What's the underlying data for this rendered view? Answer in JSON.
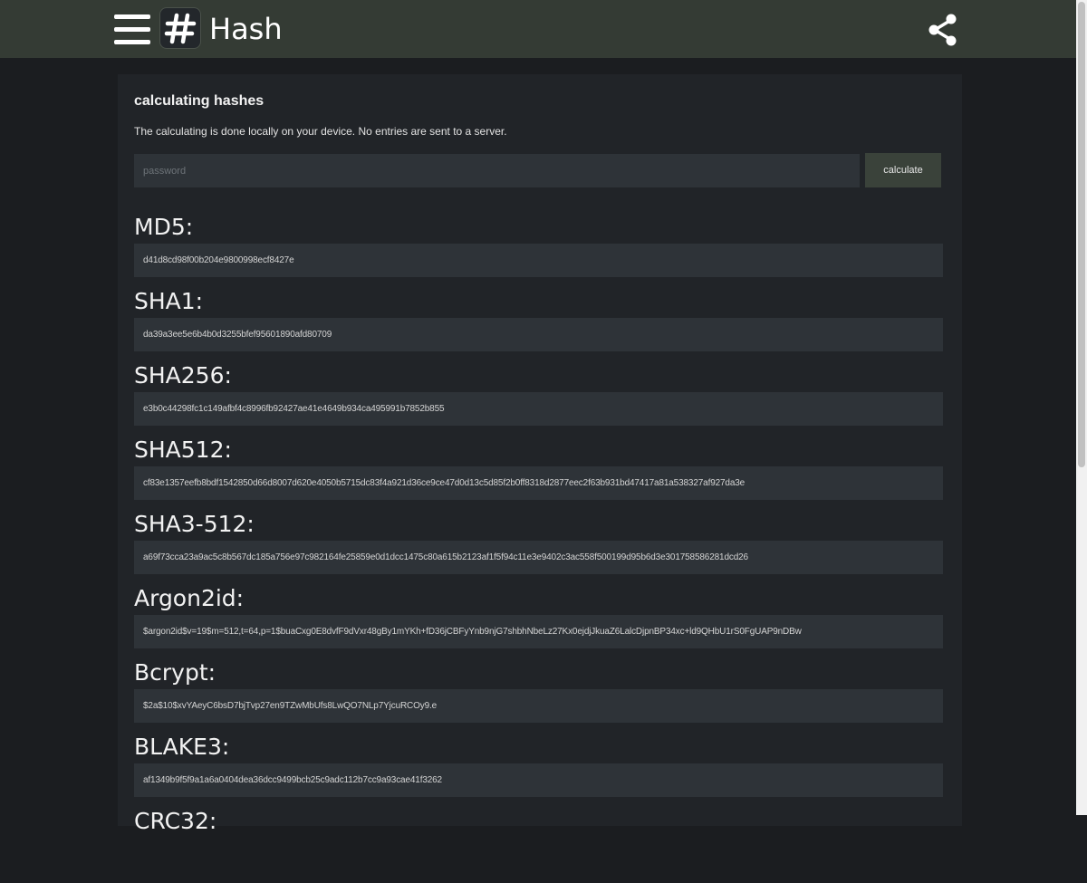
{
  "header": {
    "app_title": "Hash",
    "menu_icon": "hamburger-menu-icon",
    "logo_icon": "hash-logo-icon",
    "share_icon": "share-icon",
    "bar_color": "#343b34"
  },
  "card": {
    "title": "calculating hashes",
    "description": "The calculating is done locally on your device. No entries are sent to a server.",
    "input": {
      "value": "",
      "placeholder": "password"
    },
    "calculate_label": "calculate"
  },
  "hashes": [
    {
      "label": "MD5:",
      "value": "d41d8cd98f00b204e9800998ecf8427e"
    },
    {
      "label": "SHA1:",
      "value": "da39a3ee5e6b4b0d3255bfef95601890afd80709"
    },
    {
      "label": "SHA256:",
      "value": "e3b0c44298fc1c149afbf4c8996fb92427ae41e4649b934ca495991b7852b855"
    },
    {
      "label": "SHA512:",
      "value": "cf83e1357eefb8bdf1542850d66d8007d620e4050b5715dc83f4a921d36ce9ce47d0d13c5d85f2b0ff8318d2877eec2f63b931bd47417a81a538327af927da3e"
    },
    {
      "label": "SHA3-512:",
      "value": "a69f73cca23a9ac5c8b567dc185a756e97c982164fe25859e0d1dcc1475c80a615b2123af1f5f94c11e3e9402c3ac558f500199d95b6d3e301758586281dcd26"
    },
    {
      "label": "Argon2id:",
      "value": "$argon2id$v=19$m=512,t=64,p=1$buaCxg0E8dvfF9dVxr48gBy1mYKh+fD36jCBFyYnb9njG7shbhNbeLz27Kx0ejdjJkuaZ6LalcDjpnBP34xc+ld9QHbU1rS0FgUAP9nDBw"
    },
    {
      "label": "Bcrypt:",
      "value": "$2a$10$xvYAeyC6bsD7bjTvp27en9TZwMbUfs8LwQO7NLp7YjcuRCOy9.e"
    },
    {
      "label": "BLAKE3:",
      "value": "af1349b9f5f9a1a6a0404dea36dcc9499bcb25c9adc112b7cc9a93cae41f3262"
    },
    {
      "label": "CRC32:",
      "value": ""
    }
  ]
}
